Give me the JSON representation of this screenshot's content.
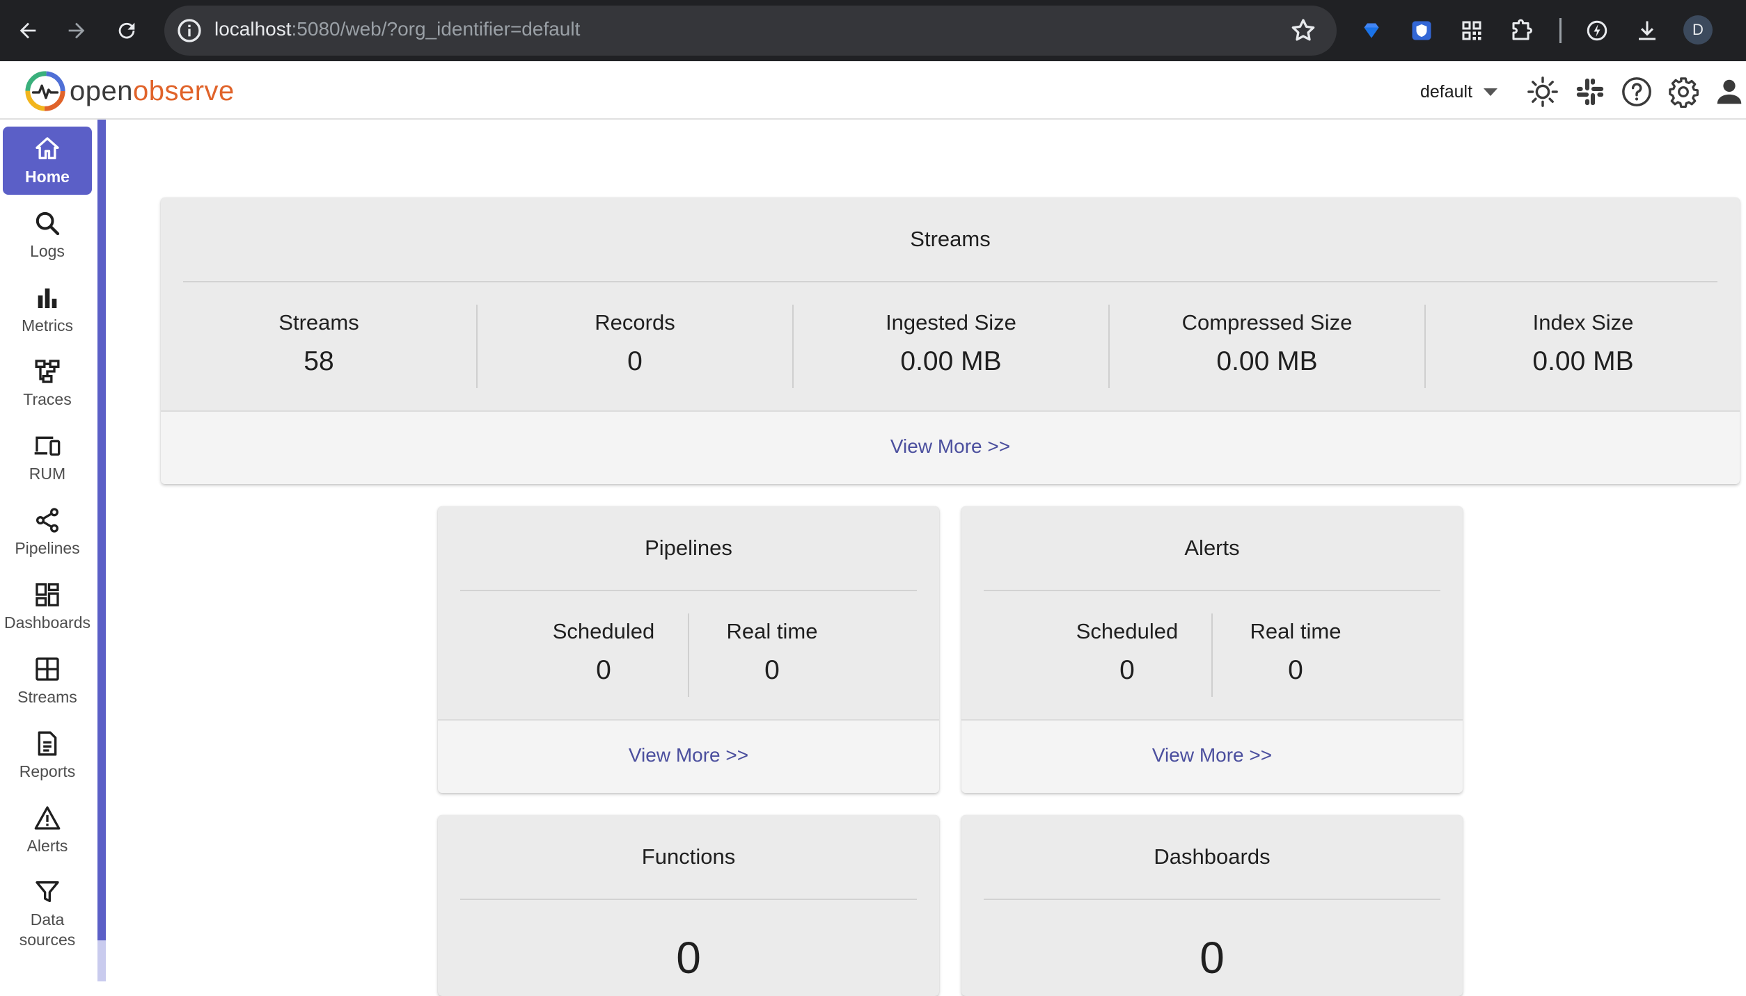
{
  "browser": {
    "url_host": "localhost",
    "url_rest": ":5080/web/?org_identifier=default",
    "profile_initial": "D"
  },
  "header": {
    "logo_text_a": "open",
    "logo_text_b": "observe",
    "org_selected": "default"
  },
  "sidebar": {
    "items": [
      {
        "label": "Home",
        "icon": "home-icon"
      },
      {
        "label": "Logs",
        "icon": "search-icon"
      },
      {
        "label": "Metrics",
        "icon": "bar-chart-icon"
      },
      {
        "label": "Traces",
        "icon": "traces-icon"
      },
      {
        "label": "RUM",
        "icon": "devices-icon"
      },
      {
        "label": "Pipelines",
        "icon": "share-icon"
      },
      {
        "label": "Dashboards",
        "icon": "dashboard-icon"
      },
      {
        "label": "Streams",
        "icon": "grid-icon"
      },
      {
        "label": "Reports",
        "icon": "document-icon"
      },
      {
        "label": "Alerts",
        "icon": "warning-icon"
      },
      {
        "label": "Data sources",
        "icon": "filter-icon"
      }
    ]
  },
  "streams_card": {
    "title": "Streams",
    "stats": [
      {
        "label": "Streams",
        "value": "58"
      },
      {
        "label": "Records",
        "value": "0"
      },
      {
        "label": "Ingested Size",
        "value": "0.00 MB"
      },
      {
        "label": "Compressed Size",
        "value": "0.00 MB"
      },
      {
        "label": "Index Size",
        "value": "0.00 MB"
      }
    ],
    "view_more": "View More >>"
  },
  "pipelines_card": {
    "title": "Pipelines",
    "stats": [
      {
        "label": "Scheduled",
        "value": "0"
      },
      {
        "label": "Real time",
        "value": "0"
      }
    ],
    "view_more": "View More >>"
  },
  "alerts_card": {
    "title": "Alerts",
    "stats": [
      {
        "label": "Scheduled",
        "value": "0"
      },
      {
        "label": "Real time",
        "value": "0"
      }
    ],
    "view_more": "View More >>"
  },
  "functions_card": {
    "title": "Functions",
    "value": "0"
  },
  "dashboards_card": {
    "title": "Dashboards",
    "value": "0"
  },
  "colors": {
    "accent": "#5b5fc7",
    "link": "#4b4f9e",
    "brand_orange": "#e0632a",
    "chrome_bg": "#202124"
  }
}
